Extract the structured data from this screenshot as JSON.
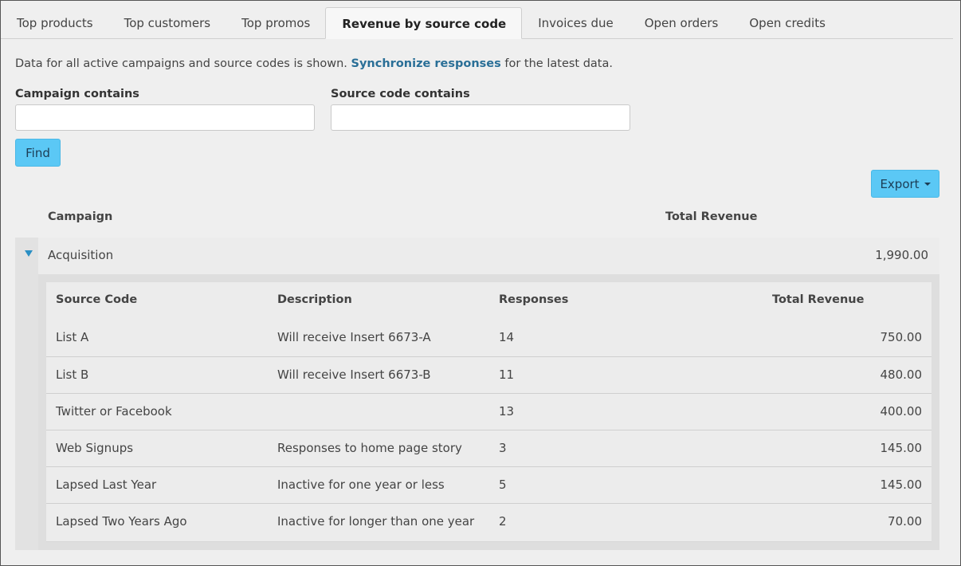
{
  "tabs": [
    {
      "label": "Top products",
      "active": false
    },
    {
      "label": "Top customers",
      "active": false
    },
    {
      "label": "Top promos",
      "active": false
    },
    {
      "label": "Revenue by source code",
      "active": true
    },
    {
      "label": "Invoices due",
      "active": false
    },
    {
      "label": "Open orders",
      "active": false
    },
    {
      "label": "Open credits",
      "active": false
    }
  ],
  "info": {
    "prefix": "Data for all active campaigns and source codes is shown. ",
    "link": "Synchronize responses",
    "suffix": " for the latest data."
  },
  "filters": {
    "campaign_label": "Campaign contains",
    "campaign_value": "",
    "source_label": "Source code contains",
    "source_value": ""
  },
  "buttons": {
    "find": "Find",
    "export": "Export"
  },
  "table": {
    "headers": {
      "campaign": "Campaign",
      "total_revenue": "Total Revenue"
    },
    "campaigns": [
      {
        "name": "Acquisition",
        "total_revenue": "1,990.00",
        "expanded": true,
        "detail_headers": {
          "source_code": "Source Code",
          "description": "Description",
          "responses": "Responses",
          "total_revenue": "Total Revenue"
        },
        "rows": [
          {
            "source_code": "List A",
            "description": "Will receive Insert 6673-A",
            "responses": "14",
            "total_revenue": "750.00"
          },
          {
            "source_code": "List B",
            "description": "Will receive Insert 6673-B",
            "responses": "11",
            "total_revenue": "480.00"
          },
          {
            "source_code": "Twitter or Facebook",
            "description": "",
            "responses": "13",
            "total_revenue": "400.00"
          },
          {
            "source_code": "Web Signups",
            "description": "Responses to home page story",
            "responses": "3",
            "total_revenue": "145.00"
          },
          {
            "source_code": "Lapsed Last Year",
            "description": "Inactive for one year or less",
            "responses": "5",
            "total_revenue": "145.00"
          },
          {
            "source_code": "Lapsed Two Years Ago",
            "description": "Inactive for longer than one year",
            "responses": "2",
            "total_revenue": "70.00"
          }
        ]
      }
    ]
  },
  "colors": {
    "accent_button": "#5bc8f5",
    "link": "#2a6f97",
    "toggle": "#2a8fc4"
  }
}
